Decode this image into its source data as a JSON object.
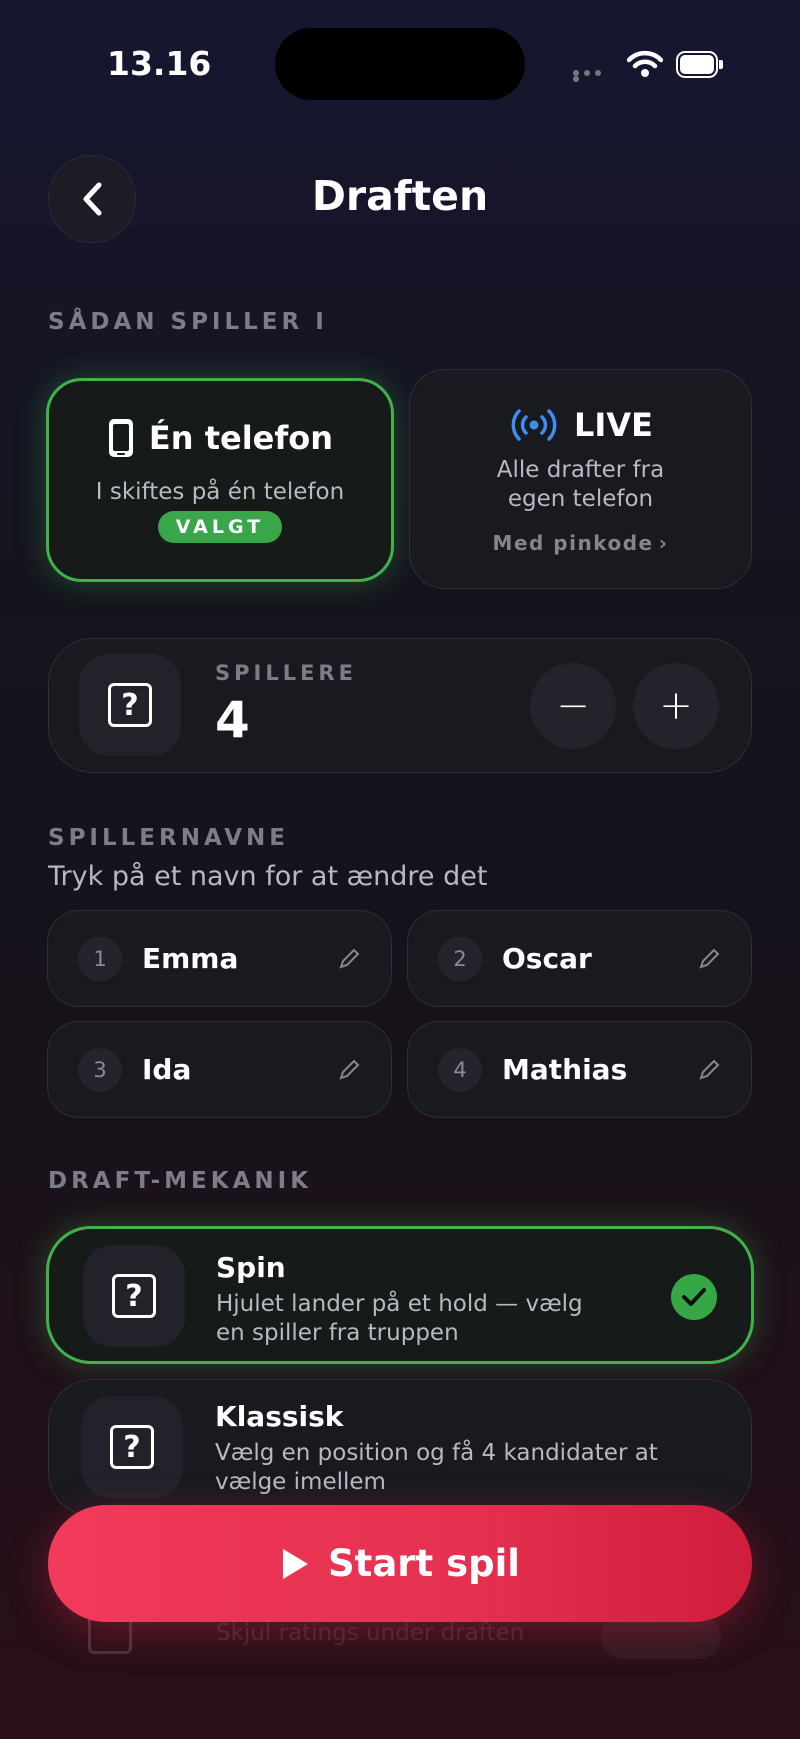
{
  "status": {
    "time": "13.16"
  },
  "header": {
    "title": "Draften"
  },
  "mode_section": {
    "label": "SÅDAN SPILLER I",
    "one_phone": {
      "title": "Én telefon",
      "subtitle": "I skiftes på én telefon",
      "badge": "VALGT"
    },
    "live": {
      "title": "LIVE",
      "subtitle_line1": "Alle drafter fra",
      "subtitle_line2": "egen telefon",
      "link": "Med pinkode"
    }
  },
  "players": {
    "label": "SPILLERE",
    "count": "4",
    "minus": "−",
    "plus": "+"
  },
  "names_section": {
    "label": "SPILLERNAVNE",
    "subtitle": "Tryk på et navn for at ændre det",
    "players": [
      {
        "num": "1",
        "name": "Emma"
      },
      {
        "num": "2",
        "name": "Oscar"
      },
      {
        "num": "3",
        "name": "Ida"
      },
      {
        "num": "4",
        "name": "Mathias"
      }
    ]
  },
  "mechanic_section": {
    "label": "DRAFT-MEKANIK",
    "options": [
      {
        "title": "Spin",
        "desc_line1": "Hjulet lander på et hold — vælg",
        "desc_line2": "en spiller fra truppen",
        "selected": true
      },
      {
        "title": "Klassisk",
        "desc_line1": "Vælg en position og få 4 kandidater at",
        "desc_line2": "vælge imellem",
        "selected": false
      }
    ],
    "hidden_option": "Skjul ratings under draften"
  },
  "start_button": {
    "label": "Start spil"
  },
  "colors": {
    "accent_green": "#3fb34a",
    "start_red": "#e5304f",
    "live_blue": "#3d8ef0"
  }
}
